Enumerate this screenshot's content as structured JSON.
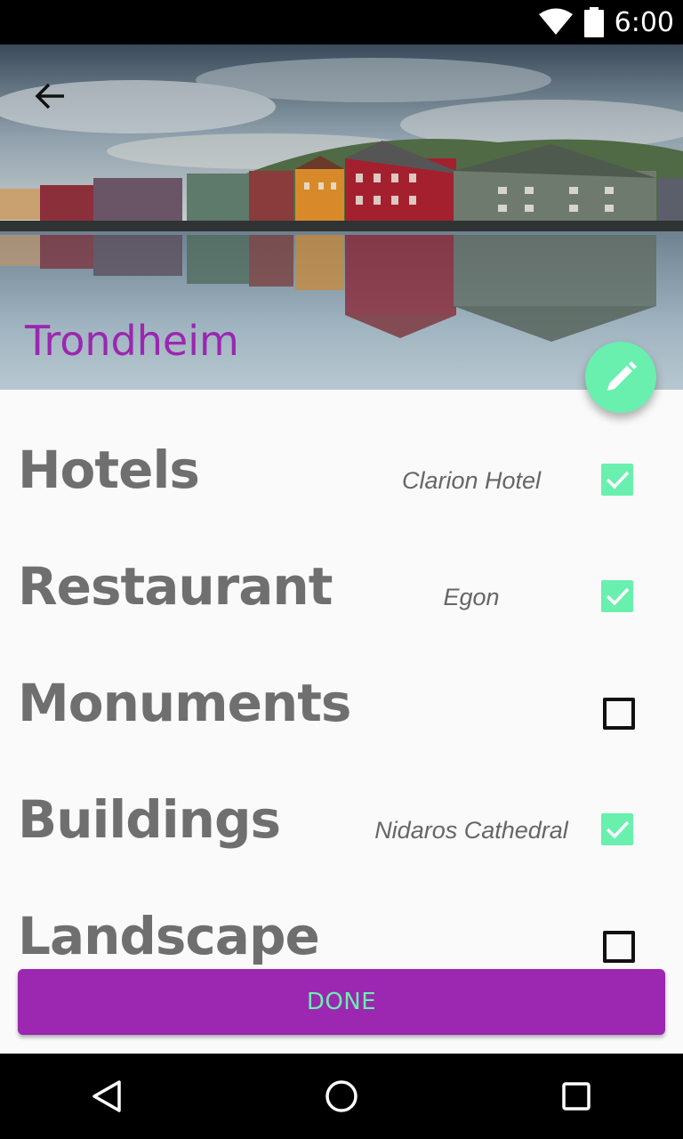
{
  "status_bar": {
    "time": "6:00"
  },
  "header": {
    "title": "Trondheim"
  },
  "categories": [
    {
      "label": "Hotels",
      "value": "Clarion Hotel",
      "checked": true
    },
    {
      "label": "Restaurant",
      "value": "Egon",
      "checked": true
    },
    {
      "label": "Monuments",
      "value": "",
      "checked": false
    },
    {
      "label": "Buildings",
      "value": "Nidaros Cathedral",
      "checked": true
    },
    {
      "label": "Landscape",
      "value": "",
      "checked": false
    }
  ],
  "actions": {
    "done_label": "DONE"
  },
  "colors": {
    "accent": "#69f0ae",
    "primary": "#9c27b0",
    "text": "#6f6f6f"
  }
}
